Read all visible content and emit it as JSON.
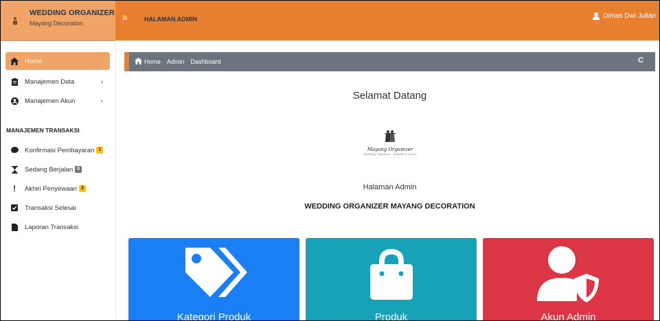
{
  "brand": {
    "title": "WEDDING ORGANIZER",
    "subtitle": "Mayang Decoration"
  },
  "topbar": {
    "label": "HALAMAN ADMIN",
    "user": "Dimas Dwi Julian"
  },
  "sidebar": {
    "items": [
      {
        "label": "Home",
        "icon": "home-icon",
        "active": true
      },
      {
        "label": "Manajemen Data",
        "icon": "clipboard-icon",
        "chevron": "‹"
      },
      {
        "label": "Manajemen Akun",
        "icon": "user-circle-icon",
        "chevron": "‹"
      }
    ],
    "section_title": "MANAJEMEN TRANSAKSI",
    "transactions": [
      {
        "label": "Konfirmasi Pembayaran",
        "icon": "comment-icon",
        "badge": "1"
      },
      {
        "label": "Sedang Berjalan",
        "icon": "hourglass-icon",
        "badge": "0"
      },
      {
        "label": "Akhiri Penyewaan",
        "icon": "exclamation-icon",
        "badge": "3"
      },
      {
        "label": "Transaksi Selesai",
        "icon": "check-square-icon"
      },
      {
        "label": "Laporan Transaksi",
        "icon": "file-icon"
      }
    ]
  },
  "breadcrumb": {
    "home": "Home",
    "admin": "Admin",
    "dashboard": "Dashboard"
  },
  "main": {
    "welcome": "Selamat Datang",
    "logo_script": "Mayang Organizer",
    "logo_tagline": "Wedding Organizer · Sekolah & Acara",
    "admin_label": "Halaman Admin",
    "org_label": "WEDDING ORGANIZER MAYANG DECORATION"
  },
  "cards": [
    {
      "title": "Kategori Produk",
      "icon": "tags-icon",
      "color": "#1a7ff5"
    },
    {
      "title": "Produk",
      "icon": "shopping-bag-icon",
      "color": "#17a2b8"
    },
    {
      "title": "Akun Admin",
      "icon": "user-shield-icon",
      "color": "#dc3545"
    }
  ],
  "colors": {
    "brand": "#f0a468",
    "topbar": "#e8802f",
    "breadcrumb": "#6c757d"
  }
}
